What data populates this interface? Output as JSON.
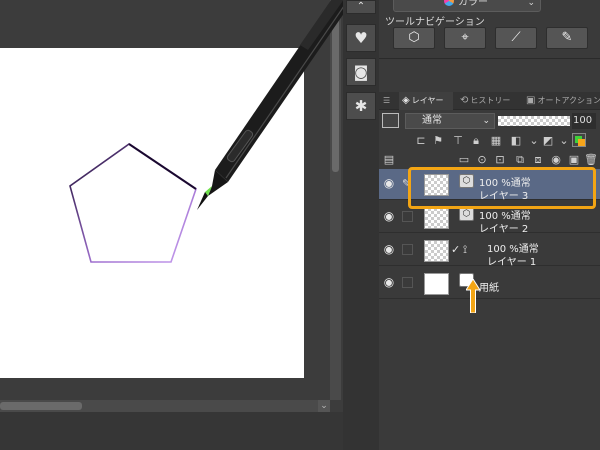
{
  "panel": {
    "color_combo_label": "カラー",
    "tool_navigation_title": "ツールナビゲーション",
    "tabs": [
      {
        "icon": "☰",
        "label": ""
      },
      {
        "icon": "◈",
        "label": "レイヤー"
      },
      {
        "icon": "⟲",
        "label": "ヒストリー"
      },
      {
        "icon": "▣",
        "label": "オートアクション"
      }
    ],
    "blend_mode": "通常",
    "opacity_value": "100"
  },
  "layers": [
    {
      "opacity": "100 %",
      "blend": "通常",
      "name": "レイヤー 3",
      "selected": true
    },
    {
      "opacity": "100 %",
      "blend": "通常",
      "name": "レイヤー 2",
      "selected": false
    },
    {
      "opacity": "100 %",
      "blend": "通常",
      "name": "レイヤー 1",
      "selected": false
    },
    {
      "name": "用紙",
      "selected": false
    }
  ],
  "colors": {
    "highlight": "#f3a514",
    "selected_row": "#5a6986",
    "main_color": "#3fd13a",
    "sub_color": "#f7a51b"
  },
  "icons": [
    "heart-icon",
    "camera-icon",
    "person-icon",
    "pen-tool-icon",
    "pointer-icon",
    "vector-icon",
    "brush-icon",
    "eye-icon",
    "lock-icon"
  ]
}
